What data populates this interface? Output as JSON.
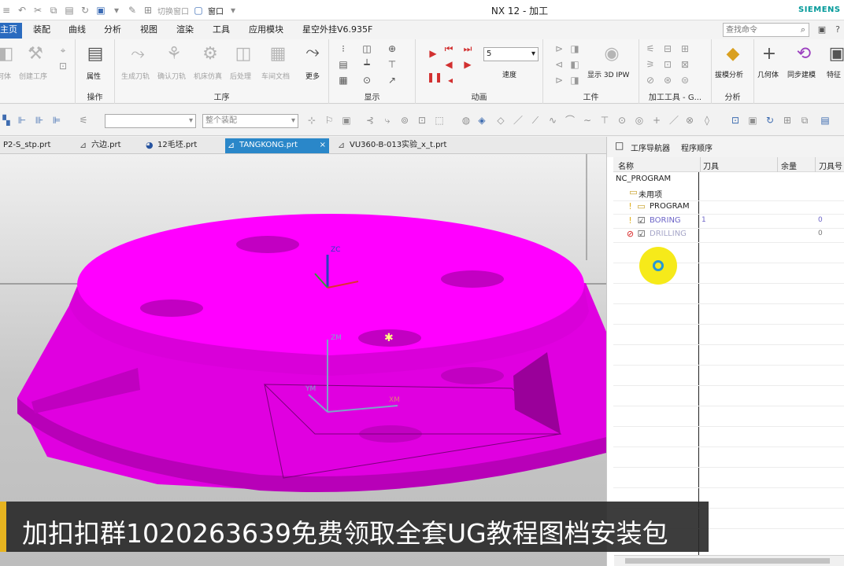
{
  "window": {
    "title": "NX 12 - 加工",
    "brand": "SIEMENS",
    "quick_access": {
      "switch_window": "切换窗口",
      "window_menu": "窗口"
    }
  },
  "ribbon_tabs": [
    {
      "label": "主页",
      "active": true
    },
    {
      "label": "装配"
    },
    {
      "label": "曲线"
    },
    {
      "label": "分析"
    },
    {
      "label": "视图"
    },
    {
      "label": "渲染"
    },
    {
      "label": "工具"
    },
    {
      "label": "应用模块"
    },
    {
      "label": "星空外挂V6.935F"
    }
  ],
  "command_search": {
    "placeholder": "查找命令"
  },
  "ribbon": {
    "create": {
      "create_op_label": "创建工序",
      "op_label": "何体"
    },
    "operations_group": {
      "label": "操作",
      "attribute": "属性"
    },
    "operation_group": {
      "label": "工序",
      "commands": [
        "生成刀轨",
        "确认刀轨",
        "机床仿真",
        "后处理",
        "车间文档"
      ],
      "more": "更多"
    },
    "display_group": {
      "label": "显示"
    },
    "animation_group": {
      "label": "动画",
      "speed_value": "5",
      "speed_label": "速度"
    },
    "workpiece_group": {
      "label": "工件",
      "show_ipw": "显示 3D IPW"
    },
    "machining_tools_group": {
      "label": "加工工具 - G..."
    },
    "analysis_group": {
      "label": "分析",
      "draft_analysis": "拔模分析"
    },
    "extra": {
      "geometry": "几何体",
      "sync_modeling": "同步建模",
      "feature": "特征"
    }
  },
  "toolbar": {
    "filter_value": "",
    "scope_value": "整个装配"
  },
  "file_tabs": [
    {
      "label": "P2-S_stp.prt"
    },
    {
      "label": "六边.prt"
    },
    {
      "label": "12毛坯.prt"
    },
    {
      "label": "TANGKONG.prt",
      "active": true
    },
    {
      "label": "VU360-B-013实验_x_t.prt"
    }
  ],
  "navigator": {
    "title": "工序导航器",
    "mode": "程序顺序",
    "columns": [
      "名称",
      "刀具",
      "余量",
      "刀具号"
    ],
    "rows": [
      {
        "name": "NC_PROGRAM",
        "tool": "",
        "stock": "",
        "tool_no": ""
      },
      {
        "name": "未用项",
        "tool": "",
        "stock": "",
        "tool_no": ""
      },
      {
        "name": "PROGRAM",
        "tool": "",
        "stock": "",
        "tool_no": ""
      },
      {
        "name": "BORING",
        "tool": "1",
        "stock": "",
        "tool_no": "0"
      },
      {
        "name": "DRILLING",
        "tool": "",
        "stock": "",
        "tool_no": "0"
      }
    ]
  },
  "viewport": {
    "model_color": "#ff00ff",
    "axes": {
      "zc": "ZC",
      "zm": "ZM",
      "ym": "YM",
      "xm": "XM"
    }
  },
  "caption": "加扣扣群1020263639免费领取全套UG教程图档安装包"
}
